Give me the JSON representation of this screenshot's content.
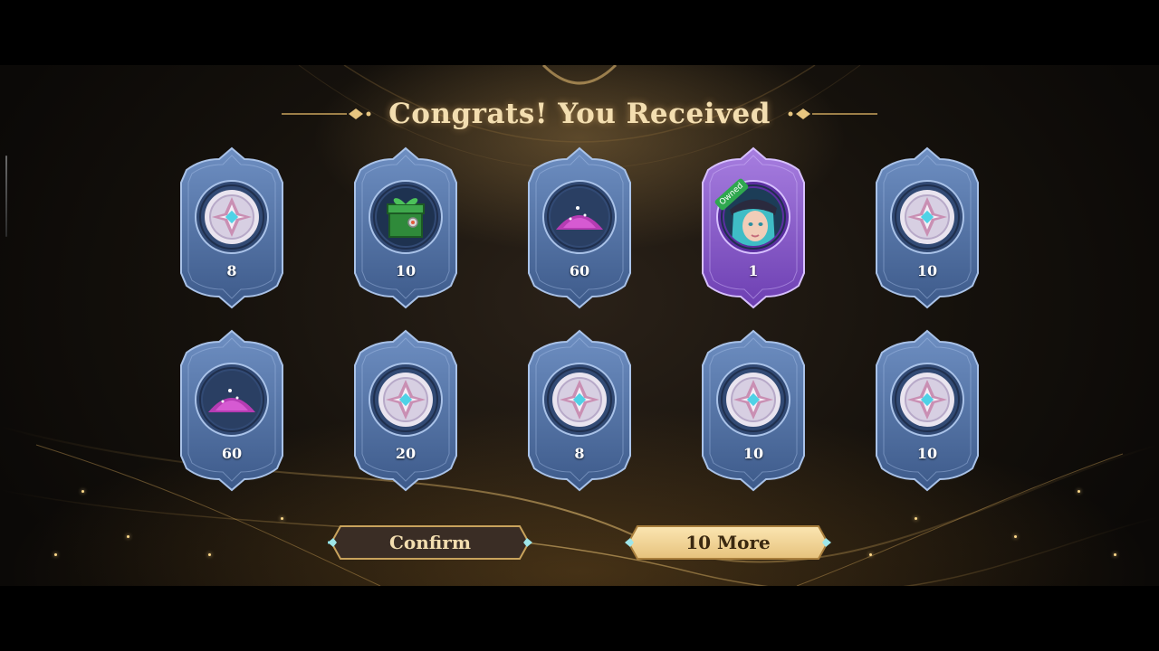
{
  "header": {
    "title": "Congrats! You Received"
  },
  "rewards": [
    {
      "qty": "8",
      "item": "star-token-icon",
      "rarity": "normal"
    },
    {
      "qty": "10",
      "item": "green-gift-box-icon",
      "rarity": "normal"
    },
    {
      "qty": "60",
      "item": "magic-dust-icon",
      "rarity": "normal"
    },
    {
      "qty": "1",
      "item": "hero-portrait-icon",
      "rarity": "epic",
      "badge": "Owned"
    },
    {
      "qty": "10",
      "item": "star-token-icon",
      "rarity": "normal"
    },
    {
      "qty": "60",
      "item": "magic-dust-icon",
      "rarity": "normal"
    },
    {
      "qty": "20",
      "item": "star-token-icon",
      "rarity": "normal"
    },
    {
      "qty": "8",
      "item": "star-token-icon",
      "rarity": "normal"
    },
    {
      "qty": "10",
      "item": "star-token-icon",
      "rarity": "normal"
    },
    {
      "qty": "10",
      "item": "star-token-icon",
      "rarity": "normal"
    }
  ],
  "buttons": {
    "confirm_label": "Confirm",
    "more_label": "10 More"
  },
  "colors": {
    "gold_text": "#f3deb0",
    "card_blue": "#4f6e9f",
    "card_purple": "#8a5cc9",
    "owned_green": "#2fa84f"
  }
}
